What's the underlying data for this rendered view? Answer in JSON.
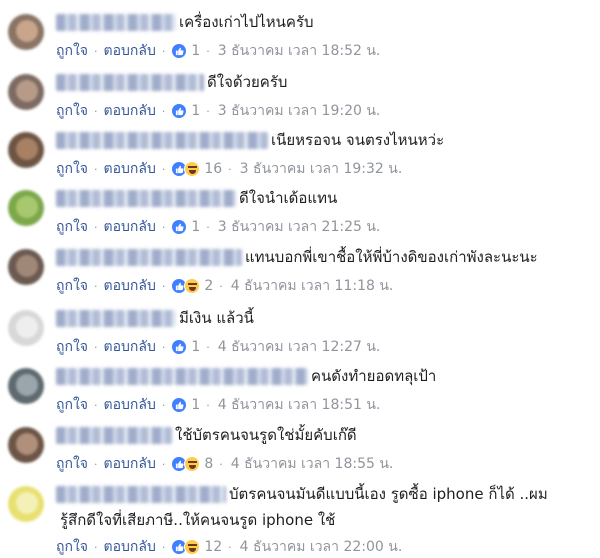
{
  "actions": {
    "like": "ถูกใจ",
    "reply": "ตอบกลับ"
  },
  "colors": {
    "link": "#365899",
    "like_blue": "#4080ff",
    "haha_yellow": "#ffcc4d"
  },
  "comments": [
    {
      "text": "เครื่องเก่าไปไหนครับ",
      "reactions": [
        "like-icon"
      ],
      "count": "1",
      "time": "3 ธันวาคม เวลา 18:52 น."
    },
    {
      "text": "ดีใจด้วยครับ",
      "reactions": [
        "like-icon"
      ],
      "count": "1",
      "time": "3 ธันวาคม เวลา 19:20 น."
    },
    {
      "text": "เนียหรอจน จนตรงไหนหว่ะ",
      "reactions": [
        "like-icon",
        "haha-icon"
      ],
      "count": "16",
      "time": "3 ธันวาคม เวลา 19:32 น."
    },
    {
      "text": "ดีใจนำเด้อแทน",
      "reactions": [
        "like-icon"
      ],
      "count": "1",
      "time": "3 ธันวาคม เวลา 21:25 น."
    },
    {
      "text": "แทนบอกพี่เขาชื้อให้พี่บ้างดิของเก่าพังละนะนะ",
      "reactions": [
        "like-icon",
        "haha-icon"
      ],
      "count": "2",
      "time": "4 ธันวาคม เวลา 11:18 น."
    },
    {
      "text": "มีเงิน แล้วนี้",
      "reactions": [
        "like-icon"
      ],
      "count": "1",
      "time": "4 ธันวาคม เวลา 12:27 น."
    },
    {
      "text": "คนดังทำยอดทลุเป้า",
      "reactions": [
        "like-icon"
      ],
      "count": "1",
      "time": "4 ธันวาคม เวลา 18:51 น."
    },
    {
      "text": "ใช้บัตรคนจนรูดใช่มั้ยคับเก๊ดี",
      "reactions": [
        "like-icon",
        "haha-icon"
      ],
      "count": "8",
      "time": "4 ธันวาคม เวลา 18:55 น."
    },
    {
      "text": "บัตรคนจนมันดีแบบนี้เอง รูดซื้อ iphone ก็ได้ ..ผม",
      "text2": "รู้สึกดีใจที่เสียภาษี..ให้คนจนรูด iphone ใช้",
      "reactions": [
        "like-icon",
        "haha-icon"
      ],
      "count": "12",
      "time": "4 ธันวาคม เวลา 22:00 น."
    }
  ]
}
